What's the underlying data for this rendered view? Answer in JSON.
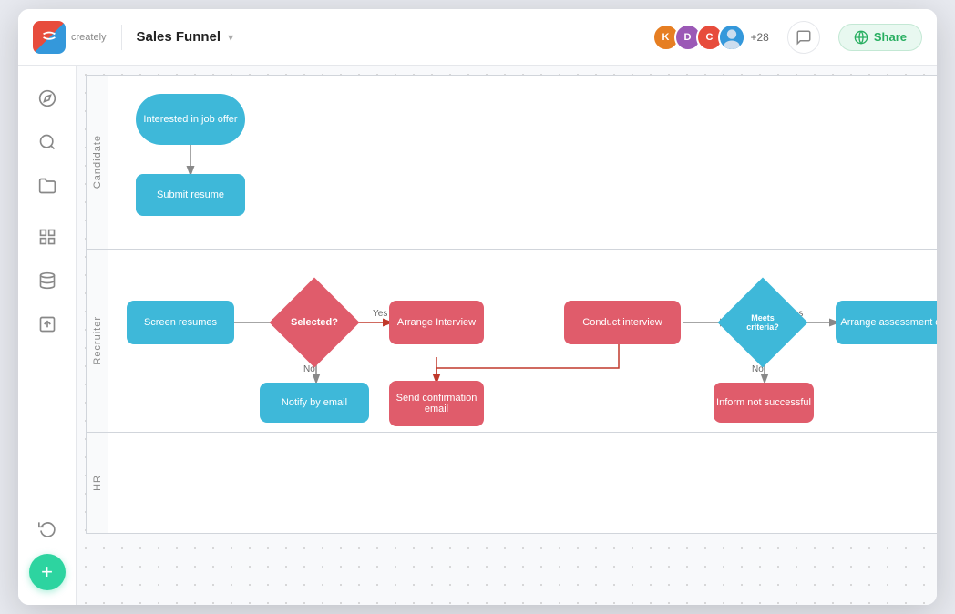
{
  "app": {
    "logo_text": "creately",
    "title": "Sales Funnel",
    "avatar_count": "+28",
    "share_label": "Share"
  },
  "sidebar": {
    "items": [
      {
        "id": "compass",
        "label": "compass-icon",
        "active": false
      },
      {
        "id": "search",
        "label": "search-icon",
        "active": false
      },
      {
        "id": "folder",
        "label": "folder-icon",
        "active": false
      },
      {
        "id": "components",
        "label": "components-icon",
        "active": false
      },
      {
        "id": "database",
        "label": "database-icon",
        "active": false
      },
      {
        "id": "upload",
        "label": "upload-icon",
        "active": false
      },
      {
        "id": "history",
        "label": "history-icon",
        "active": false
      }
    ],
    "fab_label": "+"
  },
  "swimlanes": [
    {
      "id": "candidate",
      "label": "Candidate"
    },
    {
      "id": "recruiter",
      "label": "Recruiter"
    },
    {
      "id": "hr",
      "label": "HR"
    }
  ],
  "shapes": {
    "interested": "Interested in job offer",
    "submit_resume": "Submit resume",
    "screen_resumes": "Screen resumes",
    "selected": "Selected?",
    "arrange_interview": "Arrange Interview",
    "notify_email": "Notify by email",
    "send_confirmation": "Send confirmation email",
    "conduct_interview": "Conduct interview",
    "meets_criteria": "Meets criteria?",
    "inform_not": "Inform not successful",
    "arrange_assessment": "Arrange assessment d..."
  },
  "arrow_labels": {
    "yes": "Yes",
    "no": "No"
  },
  "colors": {
    "blue": "#3eb8d9",
    "red": "#e05c6b",
    "bg": "#f8f9fb",
    "border": "#d1d5db",
    "green": "#2dd4a0",
    "share_bg": "#e8f8f0",
    "share_border": "#c3e8d4",
    "share_text": "#27ae60"
  }
}
